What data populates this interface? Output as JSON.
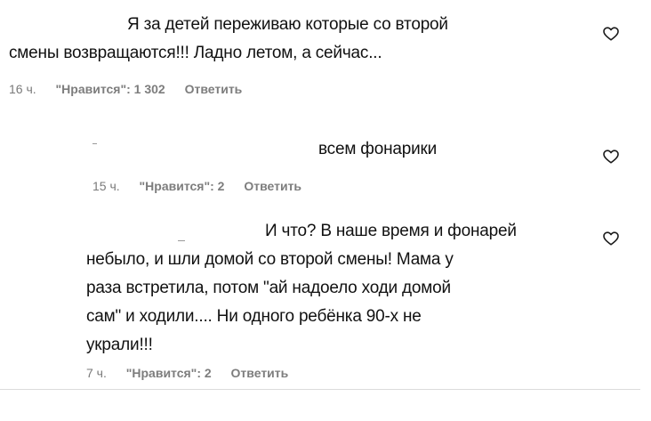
{
  "comments": [
    {
      "line1": "Я за детей переживаю которые со второй",
      "line2": "смены возвращаются!!! Ладно летом, а сейчас...",
      "time": "16 ч.",
      "likes": "\"Нравится\": 1 302",
      "reply": "Ответить"
    },
    {
      "line1": "всем фонарики",
      "time": "15 ч.",
      "likes": "\"Нравится\": 2",
      "reply": "Ответить"
    },
    {
      "line1": "И что? В наше время и фонарей",
      "line2": "небыло, и шли домой со второй смены! Мама у",
      "line3": "раза встретила, потом \"ай надоело ходи домой",
      "line4": "сам\" и ходили.... Ни одного ребёнка 90-х не",
      "line5": "украли!!!",
      "time": "7 ч.",
      "likes": "\"Нравится\": 2",
      "reply": "Ответить"
    }
  ],
  "icons": {
    "like": "heart-outline-icon"
  },
  "colors": {
    "text": "#111111",
    "meta": "#7a7a7a",
    "divider": "#dcdcdc"
  }
}
